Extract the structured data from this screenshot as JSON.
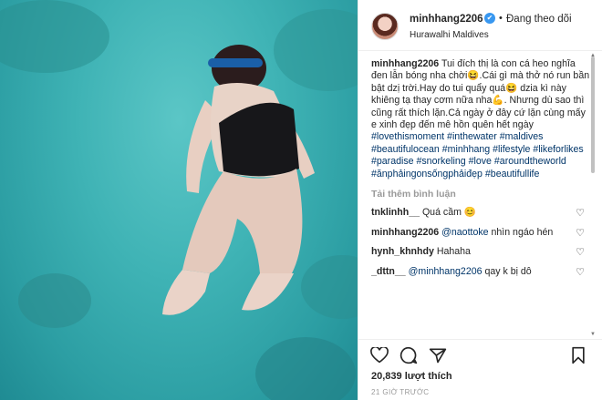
{
  "post": {
    "username": "minhhang2206",
    "verified_mark": "✔",
    "follow_dot": "•",
    "follow_status": "Đang theo dõi",
    "location": "Hurawalhi Maldives",
    "caption_user": "minhhang2206",
    "caption_text": "Tui đích thị là con cá heo nghĩa đen lẫn bóng nha chời😆.Cái gì mà thở nó run bần bật dzị trời.Hay do tui quẩy quá😆 dzia kì này khiêng tạ thay cơm nữa nha💪. Nhưng dù sao thì cũng rất thích lặn.Cả ngày ở đây cứ lặn cùng mấy e xinh đẹp đến mê hồn quên hết ngày",
    "hashtags": [
      "#lovethismoment",
      "#inthewater",
      "#maldives",
      "#beautifulocean",
      "#minhhang",
      "#lifestyle",
      "#likeforlikes",
      "#paradise",
      "#snorkeling",
      "#love",
      "#aroundtheworld",
      "#ănphảingonsốngphảiđẹp",
      "#beautifullife"
    ],
    "load_more": "Tải thêm bình luận",
    "comments": [
      {
        "user": "tnklinhh__",
        "text": "Quá cầm 😊",
        "mention": ""
      },
      {
        "user": "minhhang2206",
        "mention": "@naottoke",
        "text": "nhìn ngáo hén"
      },
      {
        "user": "hynh_khnhdy",
        "text": "Hahaha",
        "mention": ""
      },
      {
        "user": "_dttn__",
        "mention": "@minhhang2206",
        "text": "qay k bị dô"
      }
    ],
    "likes": "20,839 lượt thích",
    "time_ago": "21 GIỜ TRƯỚC"
  },
  "icons": {
    "heart": "heart-icon",
    "comment": "comment-icon",
    "share": "share-icon",
    "bookmark": "bookmark-icon"
  },
  "colors": {
    "water": "#3fb3b5",
    "link": "#003569",
    "verified": "#3897f0",
    "muted": "#999999"
  }
}
